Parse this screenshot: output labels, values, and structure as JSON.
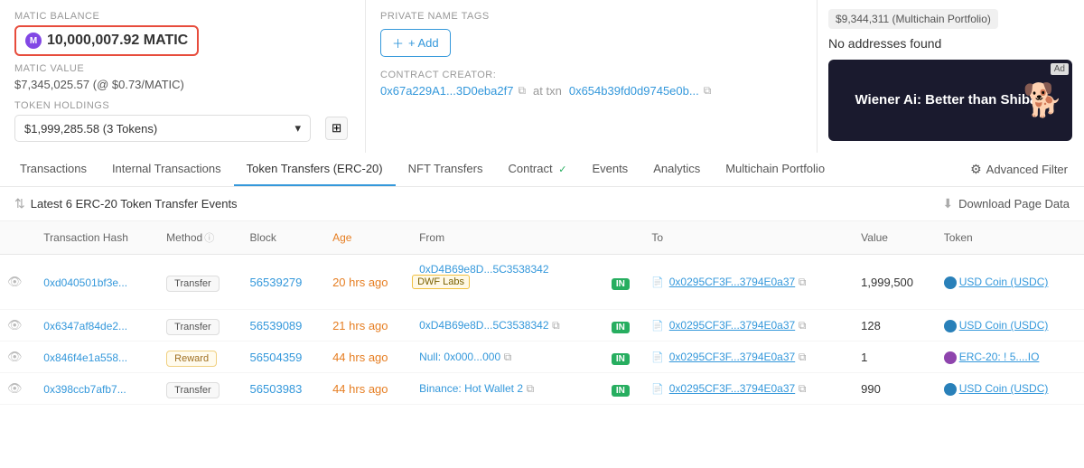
{
  "header": {
    "matic_balance_label": "MATIC BALANCE",
    "matic_amount": "10,000,007.92 MATIC",
    "matic_value_label": "MATIC VALUE",
    "matic_value": "$7,345,025.57 (@ $0.73/MATIC)",
    "token_holdings_label": "TOKEN HOLDINGS",
    "token_holdings_value": "$1,999,285.58 (3 Tokens)",
    "private_name_label": "PRIVATE NAME TAGS",
    "add_button": "+ Add",
    "contract_creator_label": "CONTRACT CREATOR:",
    "contract_creator_addr": "0x67a229A1...3D0eba2f7",
    "at_txn": "at txn",
    "contract_txn_addr": "0x654b39fd0d9745e0b...",
    "portfolio_badge": "$9,344,311 (Multichain Portfolio)",
    "no_addresses": "No addresses found",
    "ad_label": "Ad",
    "ad_text": "Wiener Ai: Better than Shiba?"
  },
  "tabs": {
    "items": [
      {
        "id": "transactions",
        "label": "Transactions",
        "active": false
      },
      {
        "id": "internal-transactions",
        "label": "Internal Transactions",
        "active": false
      },
      {
        "id": "token-transfers",
        "label": "Token Transfers (ERC-20)",
        "active": true
      },
      {
        "id": "nft-transfers",
        "label": "NFT Transfers",
        "active": false
      },
      {
        "id": "contract",
        "label": "Contract",
        "active": false,
        "check": true
      },
      {
        "id": "events",
        "label": "Events",
        "active": false
      },
      {
        "id": "analytics",
        "label": "Analytics",
        "active": false
      },
      {
        "id": "multichain-portfolio",
        "label": "Multichain Portfolio",
        "active": false
      }
    ],
    "advanced_filter": "Advanced Filter"
  },
  "events": {
    "title": "Latest 6 ERC-20 Token Transfer Events",
    "download": "Download Page Data"
  },
  "table": {
    "columns": [
      {
        "id": "eye",
        "label": ""
      },
      {
        "id": "tx-hash",
        "label": "Transaction Hash"
      },
      {
        "id": "method",
        "label": "Method"
      },
      {
        "id": "block",
        "label": "Block"
      },
      {
        "id": "age",
        "label": "Age",
        "sortable": true
      },
      {
        "id": "from",
        "label": "From"
      },
      {
        "id": "direction",
        "label": ""
      },
      {
        "id": "to",
        "label": "To"
      },
      {
        "id": "value",
        "label": "Value"
      },
      {
        "id": "token",
        "label": "Token"
      }
    ],
    "rows": [
      {
        "tx": "0xd040501bf3e...",
        "method": "Transfer",
        "method_type": "transfer",
        "block": "56539279",
        "age": "20 hrs ago",
        "from": "0xD4B69e8D...5C3538342",
        "from_label": "DWF Labs",
        "to": "0x0295CF3F...3794E0a37",
        "direction": "IN",
        "value": "1,999,500",
        "token": "USD Coin (USDC)",
        "token_type": "usdc"
      },
      {
        "tx": "0x6347af84de2...",
        "method": "Transfer",
        "method_type": "transfer",
        "block": "56539089",
        "age": "21 hrs ago",
        "from": "0xD4B69e8D...5C3538342",
        "from_label": "",
        "to": "0x0295CF3F...3794E0a37",
        "direction": "IN",
        "value": "128",
        "token": "USD Coin (USDC)",
        "token_type": "usdc"
      },
      {
        "tx": "0x846f4e1a558...",
        "method": "Reward",
        "method_type": "reward",
        "block": "56504359",
        "age": "44 hrs ago",
        "from": "Null: 0x000...000",
        "from_label": "",
        "to": "0x0295CF3F...3794E0a37",
        "direction": "IN",
        "value": "1",
        "token": "ERC-20: ! 5....IO",
        "token_type": "erc20"
      },
      {
        "tx": "0x398ccb7afb7...",
        "method": "Transfer",
        "method_type": "transfer",
        "block": "56503983",
        "age": "44 hrs ago",
        "from": "Binance: Hot Wallet 2",
        "from_label": "",
        "to": "0x0295CF3F...3794E0a37",
        "direction": "IN",
        "value": "990",
        "token": "USD Coin (USDC)",
        "token_type": "usdc"
      }
    ]
  }
}
